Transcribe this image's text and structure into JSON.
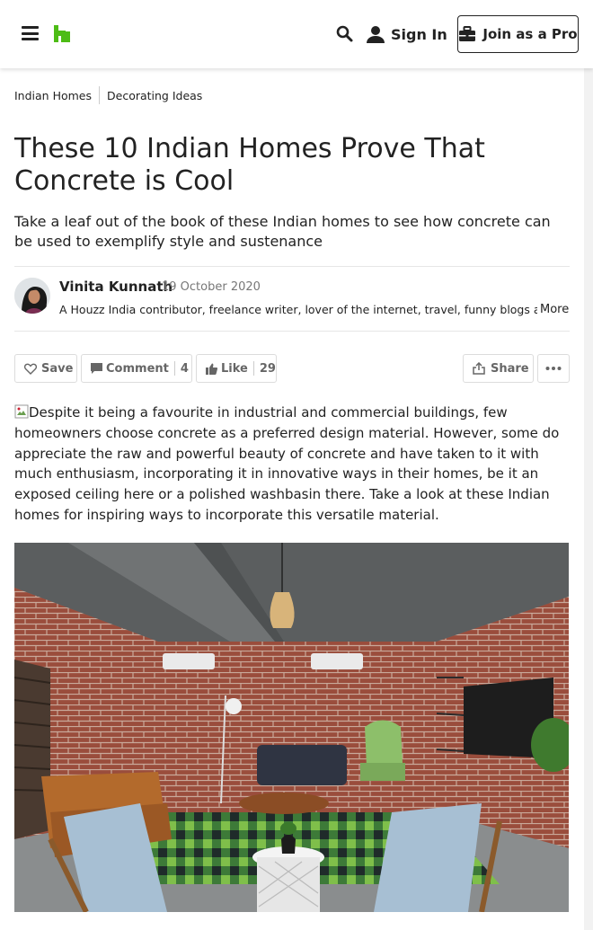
{
  "header": {
    "sign_in_label": "Sign In",
    "join_pro_label": "Join as a Pro",
    "brand_color": "#4dbc15"
  },
  "breadcrumb": [
    "Indian Homes",
    "Decorating Ideas"
  ],
  "article": {
    "title": "These 10 Indian Homes Prove That Concrete is Cool",
    "subtitle": "Take a leaf out of the book of these Indian homes to see how concrete can be used to exemplify style and sustenance",
    "intro_text": "Despite it being a favourite in industrial and commercial buildings, few homeowners choose concrete as a preferred design material. However, some do appreciate the raw and powerful beauty of concrete and have taken to it with much enthusiasm, incorporating it in innovative ways in their homes, be it an exposed ceiling here or a polished washbasin there. Take a look at these Indian homes for inspiring ways to incorporate this versatile material."
  },
  "author": {
    "name": "Vinita Kunnath",
    "date": "19 October 2020",
    "bio": "A Houzz India contributor, freelance writer, lover of the internet, travel, funny blogs a...",
    "more_label": "More"
  },
  "actions": {
    "save_label": "Save",
    "comment_label": "Comment",
    "comment_count": "4",
    "like_label": "Like",
    "like_count": "29",
    "share_label": "Share"
  },
  "icons": {
    "menu": "hamburger-icon",
    "logo": "houzz-logo",
    "search": "search-icon",
    "user": "user-icon",
    "briefcase": "briefcase-icon",
    "heart": "heart-icon",
    "comment": "comment-icon",
    "like": "thumbs-up-icon",
    "share": "share-icon",
    "more": "ellipsis-icon"
  }
}
